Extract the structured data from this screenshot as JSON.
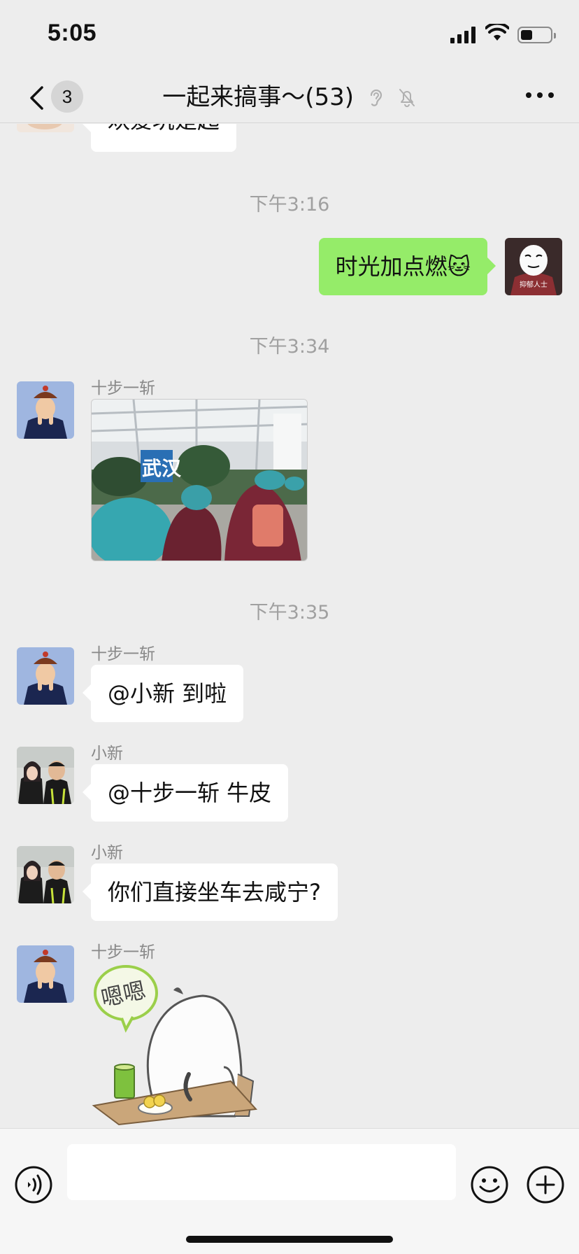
{
  "status_bar": {
    "time": "5:05",
    "icons": [
      "signal-icon",
      "wifi-icon",
      "battery-icon"
    ]
  },
  "nav": {
    "back_icon": "chevron-left-icon",
    "unread_count": "3",
    "title": "一起来搞事～(53)",
    "title_icons": [
      "ear-icon",
      "mute-bell-icon"
    ],
    "more_icon": "more-dots-icon"
  },
  "messages": [
    {
      "type": "text",
      "direction": "in",
      "text": "欢爱坑是起",
      "partial": true
    },
    {
      "type": "timestamp",
      "text": "下午3:16"
    },
    {
      "type": "text",
      "direction": "out",
      "text": "时光加点燃🐱"
    },
    {
      "type": "timestamp",
      "text": "下午3:34"
    },
    {
      "type": "image",
      "direction": "in",
      "sender": "十步一斩",
      "image_text": "武汉"
    },
    {
      "type": "timestamp",
      "text": "下午3:35"
    },
    {
      "type": "text",
      "direction": "in",
      "sender": "十步一斩",
      "text": "@小新 到啦"
    },
    {
      "type": "text",
      "direction": "in",
      "sender": "小新",
      "text": "@十步一斩 牛皮"
    },
    {
      "type": "text",
      "direction": "in",
      "sender": "小新",
      "text": "你们直接坐车去咸宁?"
    },
    {
      "type": "sticker",
      "direction": "in",
      "sender": "十步一斩",
      "sticker_text": "嗯嗯"
    }
  ],
  "my_avatar_caption": "抑郁人士",
  "input_bar": {
    "icons": [
      "voice-icon",
      "emoji-icon",
      "plus-icon"
    ],
    "value": ""
  },
  "colors": {
    "background": "#ededed",
    "bubble_out": "#95ec69",
    "bubble_in": "#ffffff",
    "timestamp": "#a0a0a0"
  }
}
